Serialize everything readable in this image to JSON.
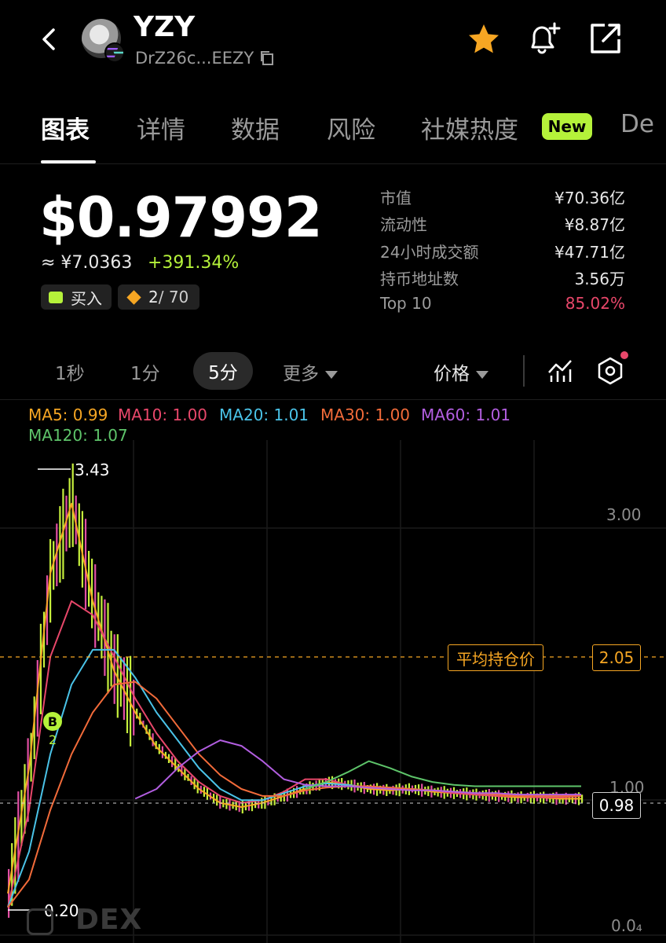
{
  "header": {
    "token_name": "YZY",
    "address": "DrZ26c...EEZY"
  },
  "tabs": [
    {
      "label": "图表"
    },
    {
      "label": "详情"
    },
    {
      "label": "数据"
    },
    {
      "label": "风险"
    },
    {
      "label": "社媒热度"
    },
    {
      "label": "De"
    }
  ],
  "new_badge": "New",
  "price": {
    "usd": "$0.97992",
    "cny": "≈ ¥7.0363",
    "change": "+391.34%"
  },
  "actions": {
    "buy_label": "买入",
    "holders_current": "2",
    "holders_total": " / 70"
  },
  "stats": [
    {
      "label": "市值",
      "value": "¥70.36亿"
    },
    {
      "label": "流动性",
      "value": "¥8.87亿"
    },
    {
      "label": "24小时成交额",
      "value": "¥47.71亿"
    },
    {
      "label": "持币地址数",
      "value": "3.56万"
    },
    {
      "label": "Top 10",
      "value": "85.02%"
    }
  ],
  "timeframes": {
    "tf_1s": "1秒",
    "tf_1m": "1分",
    "tf_5m": "5分",
    "more": "更多",
    "price_mode": "价格"
  },
  "ma": [
    {
      "label": "MA5: 0.99",
      "color": "#f6a623"
    },
    {
      "label": "MA10: 1.00",
      "color": "#e8476a"
    },
    {
      "label": "MA20: 1.01",
      "color": "#4ac3e8"
    },
    {
      "label": "MA30: 1.00",
      "color": "#f26b3a"
    },
    {
      "label": "MA60: 1.01",
      "color": "#b25ee0"
    },
    {
      "label": "MA120: 1.07",
      "color": "#5ec46a"
    }
  ],
  "chart_data": {
    "type": "line",
    "y_axis_ticks": [
      "3.00",
      "1.00",
      "0.0₄"
    ],
    "high_label": "3.43",
    "low_label": "0.20",
    "avg_label": "平均持仓价",
    "avg_value": "2.05",
    "current_value": "0.98",
    "marker_label": "B",
    "marker_count": "2",
    "ylim": [
      0,
      3.5
    ],
    "series": [
      {
        "color": "#f6a623",
        "values": [
          0.3,
          1.2,
          2.6,
          3.1,
          2.4,
          1.9,
          1.6,
          1.35,
          1.2,
          1.05,
          0.95,
          0.92,
          0.95,
          1.0,
          1.05,
          1.1,
          1.08,
          1.05,
          1.04,
          1.05,
          1.03,
          1.02,
          1.01,
          1.0,
          0.99,
          0.99,
          0.98,
          0.98
        ]
      },
      {
        "color": "#e8476a",
        "values": [
          0.2,
          0.9,
          2.0,
          2.4,
          2.3,
          2.0,
          1.7,
          1.45,
          1.25,
          1.1,
          1.0,
          0.95,
          0.97,
          1.03,
          1.12,
          1.12,
          1.08,
          1.06,
          1.05,
          1.05,
          1.04,
          1.02,
          1.01,
          1.0,
          1.0,
          0.99,
          0.99,
          1.0
        ]
      },
      {
        "color": "#4ac3e8",
        "values": [
          0.2,
          0.6,
          1.3,
          1.8,
          2.05,
          2.05,
          1.85,
          1.6,
          1.4,
          1.2,
          1.05,
          0.97,
          0.97,
          1.02,
          1.07,
          1.09,
          1.08,
          1.06,
          1.06,
          1.05,
          1.04,
          1.03,
          1.02,
          1.01,
          1.01,
          1.0,
          1.0,
          1.01
        ]
      },
      {
        "color": "#f26b3a",
        "values": [
          0.2,
          0.4,
          0.9,
          1.3,
          1.6,
          1.8,
          1.82,
          1.7,
          1.5,
          1.3,
          1.15,
          1.05,
          1.0,
          1.0,
          1.04,
          1.06,
          1.07,
          1.07,
          1.06,
          1.05,
          1.04,
          1.03,
          1.02,
          1.01,
          1.0,
          1.0,
          1.0,
          1.0
        ]
      },
      {
        "color": "#b25ee0",
        "values": [
          null,
          null,
          null,
          null,
          null,
          null,
          0.98,
          1.05,
          1.2,
          1.32,
          1.4,
          1.36,
          1.25,
          1.12,
          1.08,
          1.07,
          1.07,
          1.06,
          1.05,
          1.04,
          1.04,
          1.03,
          1.02,
          1.02,
          1.01,
          1.01,
          1.01,
          1.01
        ]
      },
      {
        "color": "#5ec46a",
        "values": [
          null,
          null,
          null,
          null,
          null,
          null,
          null,
          null,
          null,
          null,
          null,
          null,
          null,
          null,
          1.05,
          1.1,
          1.17,
          1.25,
          1.2,
          1.14,
          1.1,
          1.08,
          1.07,
          1.07,
          1.07,
          1.07,
          1.07,
          1.07
        ]
      }
    ]
  },
  "watermark": "DEX"
}
